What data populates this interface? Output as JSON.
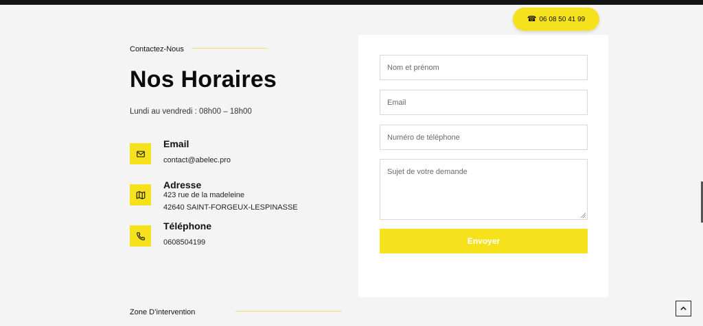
{
  "header": {
    "phone_label": "06 08 50 41 99",
    "phone_icon": "phone-icon",
    "accent_color": "#f6e11d"
  },
  "contact": {
    "kicker": "Contactez-Nous",
    "title": "Nos Horaires",
    "hours": "Lundi au vendredi : 08h00 – 18h00",
    "email": {
      "title": "Email",
      "value": "contact@abelec.pro",
      "icon": "mail-icon"
    },
    "address": {
      "title": "Adresse",
      "line1": "423 rue de la madeleine",
      "line2": "42640 SAINT-FORGEUX-LESPINASSE",
      "icon": "map-icon"
    },
    "phone": {
      "title": "Téléphone",
      "value": "0608504199",
      "icon": "phone-icon"
    }
  },
  "form": {
    "name_placeholder": "Nom et prénom",
    "email_placeholder": "Email",
    "phone_placeholder": "Numéro de téléphone",
    "message_placeholder": "Sujet de votre demande",
    "submit_label": "Envoyer"
  },
  "zone": {
    "kicker": "Zone D’intervention"
  },
  "scroll_top_icon": "chevron-up-icon"
}
